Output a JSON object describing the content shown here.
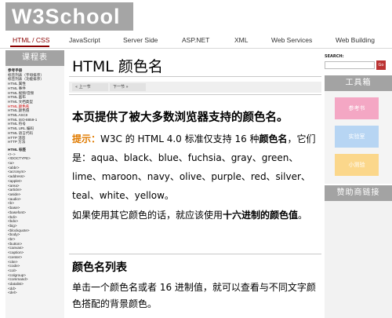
{
  "header": {
    "logo": "W3School"
  },
  "nav": {
    "items": [
      "HTML / CSS",
      "JavaScript",
      "Server Side",
      "ASP.NET",
      "XML",
      "Web Services",
      "Web Building"
    ]
  },
  "sidebar": {
    "title": "课程表",
    "links": [
      "参考手册",
      "标签列表（字母排序）",
      "标签列表（功能排序）",
      "HTML 属性",
      "HTML 事件",
      "HTML 视频/音频",
      "HTML 画布",
      "HTML 文档类型",
      "HTML 颜色名",
      "HTML 颜色值",
      "HTML ASCII",
      "HTML ISO-8859-1",
      "HTML 符号",
      "HTML URL 编码",
      "HTML 语言代码",
      "HTTP 消息",
      "HTTP 方法",
      "HTML 标签",
      "<!-->",
      "<!DOCTYPE>",
      "<a>",
      "<abbr>",
      "<acronym>",
      "<address>",
      "<applet>",
      "<area>",
      "<article>",
      "<aside>",
      "<audio>",
      "<b>",
      "<base>",
      "<basefont>",
      "<bdi>",
      "<bdo>",
      "<big>",
      "<blockquote>",
      "<body>",
      "<br>",
      "<button>",
      "<canvas>",
      "<caption>",
      "<center>",
      "<cite>",
      "<code>",
      "<col>",
      "<colgroup>",
      "<command>",
      "<datalist>",
      "<dd>",
      "<del>"
    ]
  },
  "main": {
    "title": "HTML 颜色名",
    "prev": "« 上一节",
    "next": "下一节 »",
    "intro_heading": "本页提供了被大多数浏览器支持的颜色名。",
    "tip_label": "提示：",
    "tip_text_1": "W3C 的 HTML 4.0 标准仅支持 16 种",
    "tip_strong": "颜色名",
    "tip_text_2": "，它们是：aqua、black、blue、fuchsia、gray、green、lime、maroon、navy、olive、purple、red、silver、teal、white、yellow。",
    "hex_text_1": "如果使用其它颜色的话，就应该使用",
    "hex_strong": "十六进制的颜色值",
    "hex_text_2": "。",
    "list_heading": "颜色名列表",
    "list_desc": "单击一个颜色名或者 16 进制值，就可以查看与不同文字颜色搭配的背景颜色。"
  },
  "right": {
    "search_label": "SEARCH:",
    "search_go": "Go",
    "tools_title": "工具箱",
    "tools": [
      "参考书",
      "实验室",
      "小测验"
    ],
    "sponsor_title": "赞助商链接"
  }
}
